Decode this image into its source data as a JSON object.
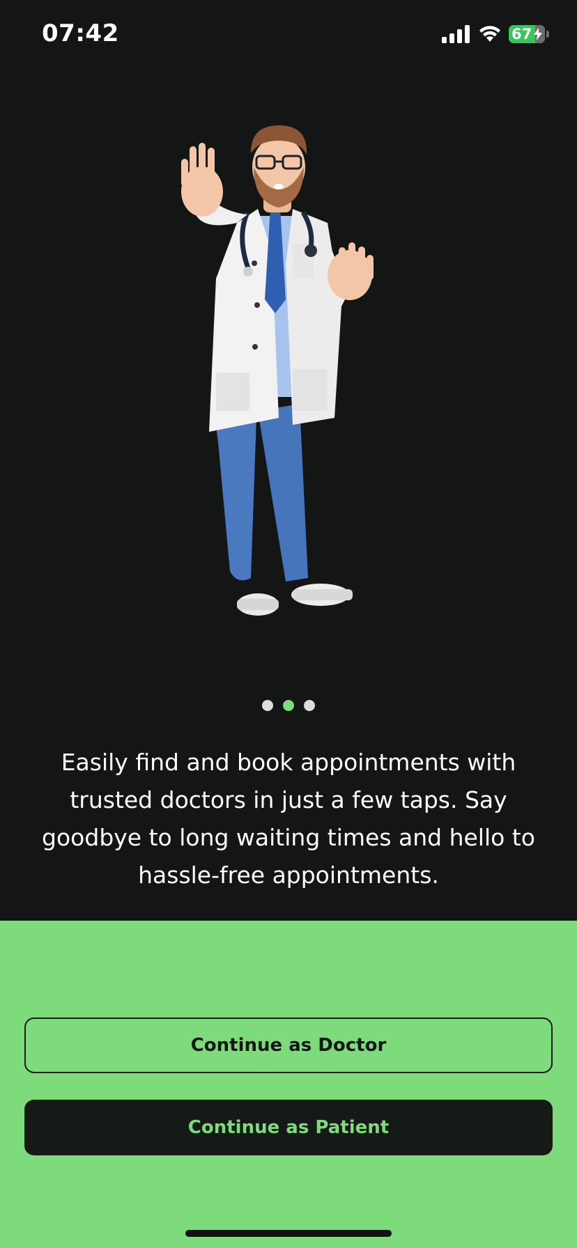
{
  "status_bar": {
    "time": "07:42",
    "battery_percent": "67",
    "battery_color": "#35c759"
  },
  "onboarding": {
    "illustration_icon": "doctor-character-illustration",
    "pagination": {
      "total": 3,
      "active_index": 1
    },
    "description": "Easily find and book appointments with trusted doctors in just a few taps. Say goodbye to long waiting times and hello to hassle-free appointments."
  },
  "actions": {
    "doctor_label": "Continue as Doctor",
    "patient_label": "Continue as Patient"
  },
  "colors": {
    "background": "#141515",
    "accent": "#7ddb7c"
  }
}
